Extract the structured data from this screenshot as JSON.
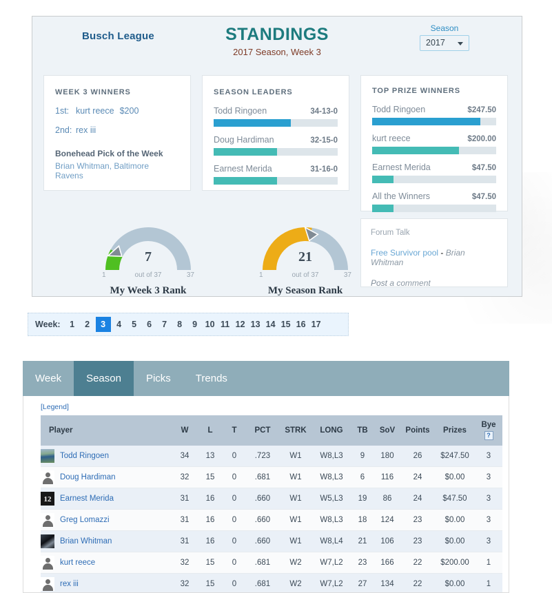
{
  "header": {
    "league_name": "Busch League",
    "title": "STANDINGS",
    "subtitle": "2017 Season, Week 3",
    "season_label": "Season",
    "season_value": "2017"
  },
  "cards": {
    "winners": {
      "title": "WEEK 3 WINNERS",
      "rows": [
        {
          "pos": "1st:",
          "name": "kurt reece",
          "amount": "$200"
        },
        {
          "pos": "2nd:",
          "name": "rex iii",
          "amount": ""
        }
      ],
      "bonehead_title": "Bonehead Pick of the Week",
      "bonehead_name": "Brian Whitman, Baltimore Ravens"
    },
    "leaders": {
      "title": "SEASON LEADERS",
      "items": [
        {
          "name": "Todd Ringoen",
          "value": "34-13-0",
          "pct": 62,
          "color": "#2a9fd0"
        },
        {
          "name": "Doug Hardiman",
          "value": "32-15-0",
          "pct": 51,
          "color": "#44bbb5"
        },
        {
          "name": "Earnest Merida",
          "value": "31-16-0",
          "pct": 51,
          "color": "#44bbb5"
        }
      ]
    },
    "prizes": {
      "title": "TOP PRIZE WINNERS",
      "items": [
        {
          "name": "Todd Ringoen",
          "value": "$247.50",
          "pct": 87,
          "color": "#2a9fd0"
        },
        {
          "name": "kurt reece",
          "value": "$200.00",
          "pct": 70,
          "color": "#44bbb5"
        },
        {
          "name": "Earnest Merida",
          "value": "$47.50",
          "pct": 17,
          "color": "#44bbb5"
        },
        {
          "name": "All the Winners",
          "value": "$47.50",
          "pct": 17,
          "color": "#44bbb5"
        }
      ]
    },
    "forum": {
      "title": "Forum Talk",
      "post_link": "Free Survivor pool",
      "post_sep": " - ",
      "post_author": "Brian Whitman",
      "comment_link": "Post",
      "comment_rest": " a comment"
    }
  },
  "gauges": [
    {
      "id": "week",
      "value": "7",
      "min": "1",
      "center": "out of 37",
      "max": "37",
      "label": "My Week 3 Rank",
      "fill_pct": 16,
      "fill_color": "#4fbf21",
      "track_color": "#b3c6d4"
    },
    {
      "id": "season",
      "value": "21",
      "min": "1",
      "center": "out of 37",
      "max": "37",
      "label": "My Season Rank",
      "fill_pct": 55,
      "fill_color": "#edac17",
      "track_color": "#b3c6d4"
    }
  ],
  "week_selector": {
    "label": "Week:",
    "weeks": [
      "1",
      "2",
      "3",
      "4",
      "5",
      "6",
      "7",
      "8",
      "9",
      "10",
      "11",
      "12",
      "13",
      "14",
      "15",
      "16",
      "17"
    ],
    "active": "3"
  },
  "tabs": [
    {
      "label": "Week",
      "active": false
    },
    {
      "label": "Season",
      "active": true
    },
    {
      "label": "Picks",
      "active": false
    },
    {
      "label": "Trends",
      "active": false
    }
  ],
  "table": {
    "legend_label": "[Legend]",
    "columns": [
      "Player",
      "W",
      "L",
      "T",
      "PCT",
      "STRK",
      "LONG",
      "TB",
      "SoV",
      "Points",
      "Prizes",
      "Bye"
    ],
    "bye_help_icon": "?",
    "rows": [
      {
        "avatar": "photo-todd",
        "name": "Todd Ringoen",
        "W": "34",
        "L": "13",
        "T": "0",
        "PCT": ".723",
        "STRK": "W1",
        "LONG": "W8,L3",
        "TB": "9",
        "SoV": "180",
        "Points": "26",
        "Prizes": "$247.50",
        "Bye": "3"
      },
      {
        "avatar": "silhouette",
        "name": "Doug Hardiman",
        "W": "32",
        "L": "15",
        "T": "0",
        "PCT": ".681",
        "STRK": "W1",
        "LONG": "W8,L3",
        "TB": "6",
        "SoV": "116",
        "Points": "24",
        "Prizes": "$0.00",
        "Bye": "3"
      },
      {
        "avatar": "photo-jersey",
        "name": "Earnest Merida",
        "W": "31",
        "L": "16",
        "T": "0",
        "PCT": ".660",
        "STRK": "W1",
        "LONG": "W5,L3",
        "TB": "19",
        "SoV": "86",
        "Points": "24",
        "Prizes": "$47.50",
        "Bye": "3"
      },
      {
        "avatar": "silhouette",
        "name": "Greg Lomazzi",
        "W": "31",
        "L": "16",
        "T": "0",
        "PCT": ".660",
        "STRK": "W1",
        "LONG": "W8,L3",
        "TB": "18",
        "SoV": "124",
        "Points": "23",
        "Prizes": "$0.00",
        "Bye": "3"
      },
      {
        "avatar": "photo-brian",
        "name": "Brian Whitman",
        "W": "31",
        "L": "16",
        "T": "0",
        "PCT": ".660",
        "STRK": "W1",
        "LONG": "W8,L4",
        "TB": "21",
        "SoV": "106",
        "Points": "23",
        "Prizes": "$0.00",
        "Bye": "3"
      },
      {
        "avatar": "silhouette",
        "name": "kurt reece",
        "W": "32",
        "L": "15",
        "T": "0",
        "PCT": ".681",
        "STRK": "W2",
        "LONG": "W7,L2",
        "TB": "23",
        "SoV": "166",
        "Points": "22",
        "Prizes": "$200.00",
        "Bye": "1"
      },
      {
        "avatar": "silhouette",
        "name": "rex iii",
        "W": "32",
        "L": "15",
        "T": "0",
        "PCT": ".681",
        "STRK": "W2",
        "LONG": "W7,L2",
        "TB": "27",
        "SoV": "134",
        "Points": "22",
        "Prizes": "$0.00",
        "Bye": "1"
      }
    ]
  }
}
